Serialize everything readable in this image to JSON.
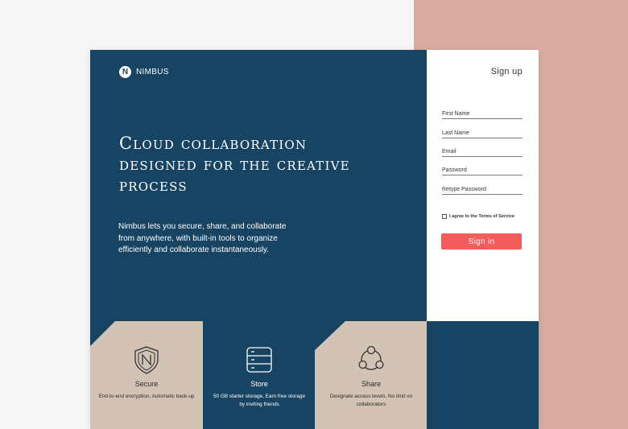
{
  "brand": {
    "mark": "N",
    "name": "NIMBUS"
  },
  "hero": {
    "headline": "Cloud collaboration designed for the creative process",
    "description": "Nimbus lets you secure, share, and collaborate from anywhere, with built-in tools to organize efficiently and collaborate instantaneously."
  },
  "features": [
    {
      "title": "Secure",
      "desc": "End-to-end encryption, Automatic back-up",
      "icon": "shield-icon"
    },
    {
      "title": "Store",
      "desc": "50 GB starter storage, Earn free storage by inviting friends",
      "icon": "server-icon"
    },
    {
      "title": "Share",
      "desc": "Designate access levels, No limit on collaborators",
      "icon": "share-icon"
    }
  ],
  "signup": {
    "title": "Sign up",
    "fields": [
      "First Name",
      "Last Name",
      "Email",
      "Password",
      "Retype Password"
    ],
    "terms": "I agree to the Terms of Service",
    "button": "Sign in"
  },
  "colors": {
    "navy": "#164462",
    "tan": "#d2c3b5",
    "pink": "#d9aca0",
    "accent": "#f45b5b"
  }
}
